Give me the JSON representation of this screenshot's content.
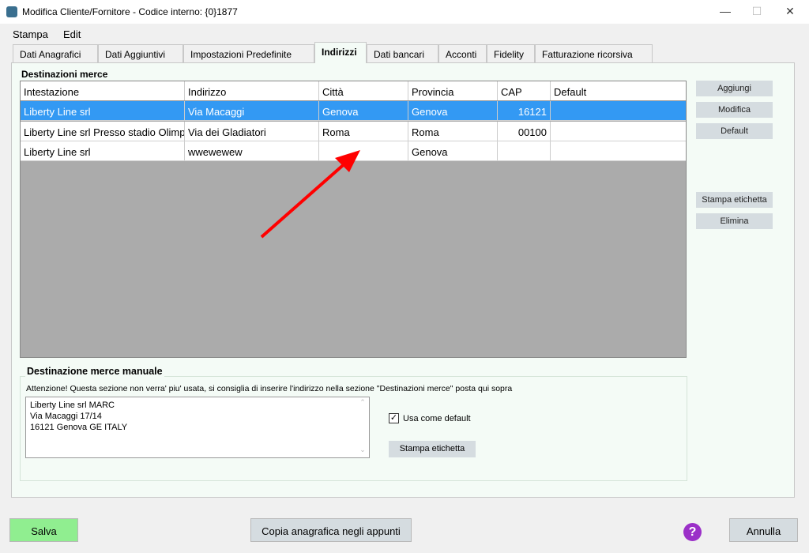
{
  "window": {
    "title": "Modifica Cliente/Fornitore - Codice interno: {0}1877",
    "minimize": "—",
    "maximize": "☐",
    "close": "✕"
  },
  "menu": [
    "Stampa",
    "Edit"
  ],
  "tabs": [
    {
      "label": "Dati Anagrafici"
    },
    {
      "label": "Dati Aggiuntivi"
    },
    {
      "label": "Impostazioni Predefinite"
    },
    {
      "label": "Indirizzi",
      "selected": true
    },
    {
      "label": "Dati bancari"
    },
    {
      "label": "Acconti"
    },
    {
      "label": "Fidelity"
    },
    {
      "label": "Fatturazione ricorsiva"
    }
  ],
  "destinazioni": {
    "title": "Destinazioni merce",
    "columns": [
      "Intestazione",
      "Indirizzo",
      "Città",
      "Provincia",
      "CAP",
      "Default"
    ],
    "rows": [
      [
        "Liberty Line srl",
        "Via Macaggi",
        "Genova",
        "Genova",
        "16121",
        ""
      ],
      [
        "Liberty Line srl Presso stadio Olimpico",
        "Via dei Gladiatori",
        "Roma",
        "Roma",
        "00100",
        ""
      ],
      [
        "Liberty Line srl",
        "wwewewew",
        "",
        "Genova",
        "",
        ""
      ]
    ],
    "selected_row": 0,
    "buttons": {
      "add": "Aggiungi",
      "edit": "Modifica",
      "default": "Default",
      "print_label": "Stampa etichetta",
      "delete": "Elimina"
    }
  },
  "manuale": {
    "title": "Destinazione merce manuale",
    "note": "Attenzione! Questa sezione non verra' piu' usata, si consiglia di inserire l'indirizzo nella sezione \"Destinazioni merce\" posta qui sopra",
    "address": "Liberty Line srl MARC\nVia Macaggi 17/14\n16121 Genova GE ITALY",
    "use_default_label": "Usa come default",
    "use_default_checked": true,
    "print_label": "Stampa etichetta"
  },
  "footer": {
    "save": "Salva",
    "copy": "Copia anagrafica negli appunti",
    "help": "?",
    "cancel": "Annulla"
  },
  "colors": {
    "selection": "#3399f3",
    "save": "#90ee90",
    "help": "#9b30c8",
    "annotation_arrow": "#ff0000"
  }
}
